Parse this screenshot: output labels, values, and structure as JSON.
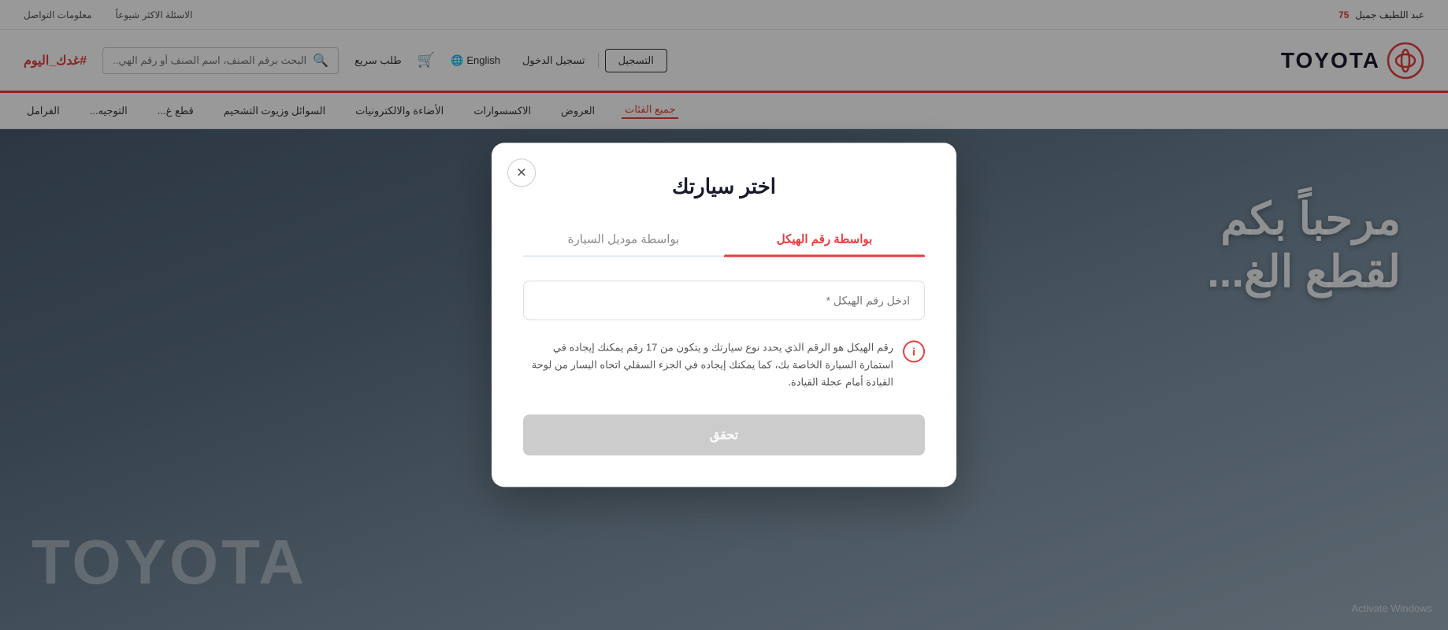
{
  "topbar": {
    "faq_label": "الاسئلة الاكثر شيوعاً",
    "contact_label": "معلومات التواصل",
    "brand_label": "عبد اللطيف جميل",
    "years_label": "75"
  },
  "header": {
    "logo_text": "TOYOTA",
    "hashtag": "#غدك_اليوم",
    "search_placeholder": "البحث برقم الصنف، اسم الصنف أو رقم الهي...",
    "register_label": "التسجيل",
    "login_label": "تسجيل الدخول",
    "lang_label": "English",
    "quick_order_label": "طلب سريع",
    "cart_icon": "🛒"
  },
  "navbar": {
    "items": [
      {
        "label": "الاكسسوارات",
        "active": false
      },
      {
        "label": "الأضاءة والالكترونيات",
        "active": false
      },
      {
        "label": "السوائل وزيوت التشحيم",
        "active": false
      },
      {
        "label": "قطع غ...",
        "active": false
      },
      {
        "label": "التوجيه...",
        "active": false
      },
      {
        "label": "الفرامل",
        "active": false
      }
    ],
    "all_categories_label": "جميع الفئات",
    "offers_label": "العروض"
  },
  "hero": {
    "text_line1": "مرحباً بكم",
    "text_line2": "لقطع الغ..."
  },
  "modal": {
    "title": "اختر سيارتك",
    "tab_vin_label": "بواسطة رقم الهيكل",
    "tab_model_label": "بواسطة موديل السيارة",
    "vin_placeholder": "ادخل رقم الهيكل *",
    "info_text": "رقم الهيكل هو الرقم الذي يحدد نوع سيارتك و يتكون من 17 رقم يمكنك إيجاده في استمارة السيارة الخاصة بك، كما يمكنك إيجاده في الجزء السفلي اتجاه اليسار من لوحة القيادة أمام عجلة القيادة.",
    "submit_label": "تحقق",
    "close_icon": "✕"
  },
  "watermark": {
    "text": "Activate Windows"
  }
}
